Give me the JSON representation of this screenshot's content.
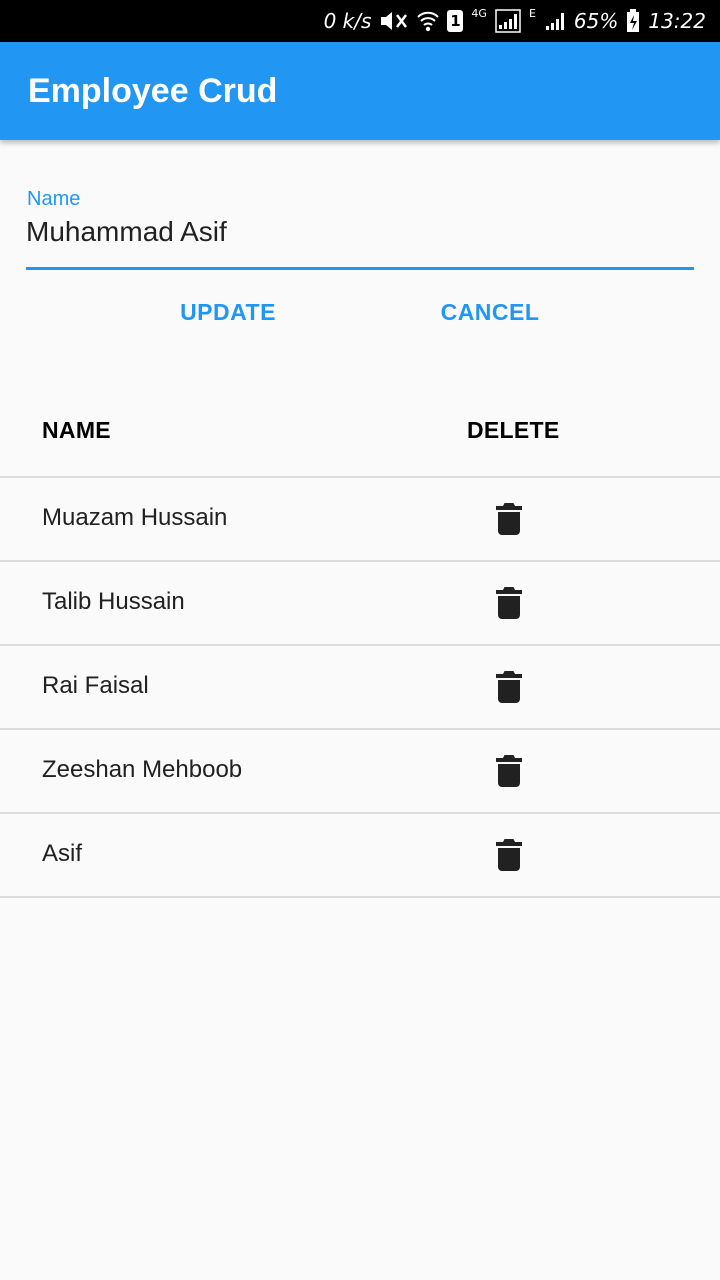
{
  "status_bar": {
    "speed": "0 k/s",
    "sim_slot": "1",
    "network_primary": "4G",
    "network_secondary": "E",
    "battery": "65%",
    "time": "13:22"
  },
  "app_bar": {
    "title": "Employee Crud"
  },
  "form": {
    "name_label": "Name",
    "name_value": "Muhammad Asif",
    "update_label": "UPDATE",
    "cancel_label": "CANCEL"
  },
  "table": {
    "headers": {
      "name": "NAME",
      "delete": "DELETE"
    },
    "rows": [
      {
        "name": "Muazam Hussain"
      },
      {
        "name": "Talib Hussain"
      },
      {
        "name": "Rai Faisal"
      },
      {
        "name": "Zeeshan Mehboob"
      },
      {
        "name": "Asif"
      }
    ]
  },
  "colors": {
    "primary": "#2196f3",
    "background": "#fafafa",
    "icon": "#212121"
  },
  "icons": {
    "delete": "trash-icon"
  }
}
